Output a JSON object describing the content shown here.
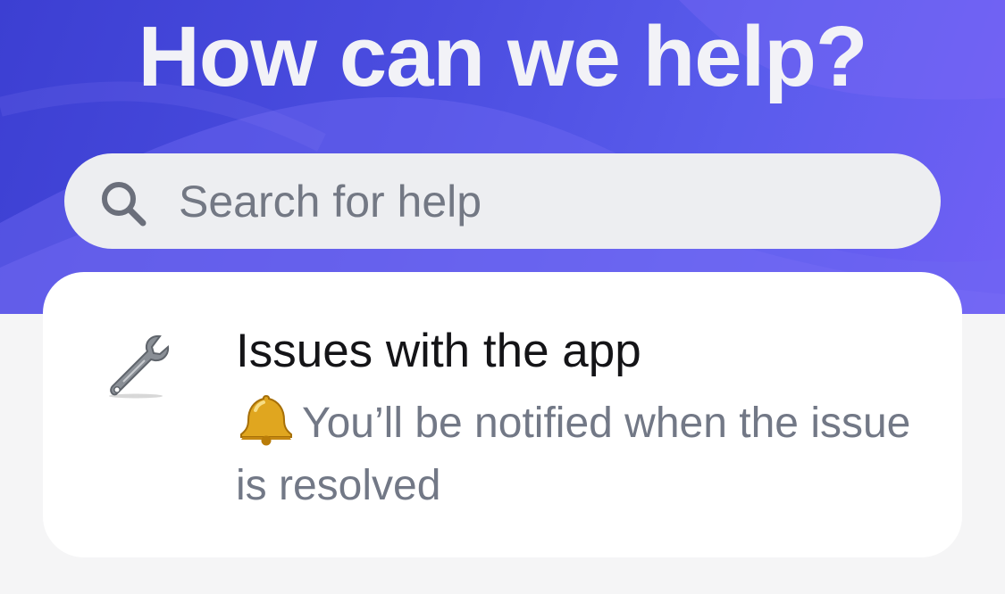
{
  "hero": {
    "title": "How can we help?"
  },
  "search": {
    "icon": "search-icon",
    "placeholder": "Search for help"
  },
  "card": {
    "icon": "wrench-icon",
    "title": "Issues with the app",
    "subtitle_icon": "bell-icon",
    "subtitle": "You’ll be notified when the issue is resolved"
  },
  "colors": {
    "hero_start": "#3c3fd2",
    "hero_end": "#7160f5",
    "page_background": "#f5f5f6",
    "card_background": "#ffffff",
    "search_background": "#edeef1",
    "title_text": "#141417",
    "muted_text": "#727886"
  }
}
